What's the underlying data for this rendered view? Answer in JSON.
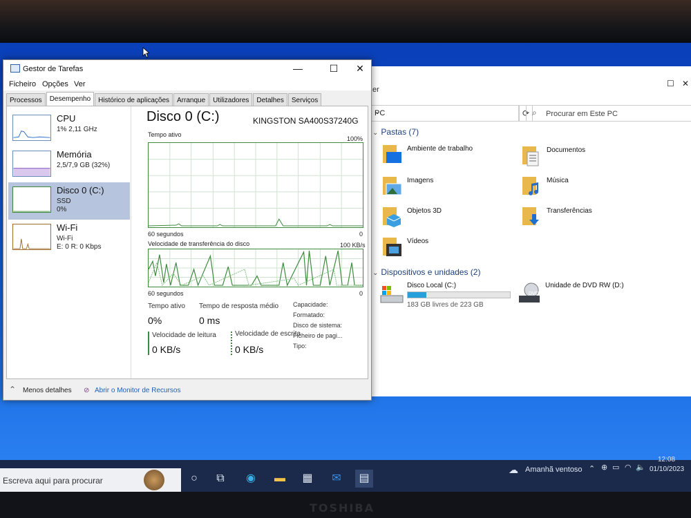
{
  "task_manager": {
    "title": "Gestor de Tarefas",
    "menu": [
      "Ficheiro",
      "Opções",
      "Ver"
    ],
    "tabs": [
      "Processos",
      "Desempenho",
      "Histórico de aplicações",
      "Arranque",
      "Utilizadores",
      "Detalhes",
      "Serviços"
    ],
    "active_tab": "Desempenho",
    "perf_items": [
      {
        "name": "CPU",
        "line1": "1% 2,11 GHz",
        "line2": ""
      },
      {
        "name": "Memória",
        "line1": "2,5/7,9 GB (32%)",
        "line2": ""
      },
      {
        "name": "Disco 0 (C:)",
        "line1": "SSD",
        "line2": "0%"
      },
      {
        "name": "Wi-Fi",
        "line1": "Wi-Fi",
        "line2": "E: 0 R: 0 Kbps"
      }
    ],
    "disk": {
      "title": "Disco 0 (C:)",
      "model": "KINGSTON SA400S37240G",
      "graph1_label": "Tempo ativo",
      "graph1_max": "100%",
      "graph1_time": "60 segundos",
      "graph1_min": "0",
      "graph2_label": "Velocidade de transferência do disco",
      "graph2_max": "100 KB/s",
      "graph2_time": "60 segundos",
      "graph2_min": "0",
      "active_time_label": "Tempo ativo",
      "active_time_value": "0%",
      "response_label": "Tempo de resposta médio",
      "response_value": "0 ms",
      "read_label": "Velocidade de leitura",
      "read_value": "0 KB/s",
      "write_label": "Velocidade de escrita",
      "write_value": "0 KB/s",
      "props": [
        "Capacidade:",
        "Formatado:",
        "Disco de sistema:",
        "Ficheiro de pagi...",
        "Tipo:"
      ]
    },
    "footer": {
      "less_details": "Menos detalhes",
      "resource_monitor": "Abrir o Monitor de Recursos"
    }
  },
  "explorer": {
    "title_partial": "er",
    "address": "PC",
    "search_placeholder": "Procurar em Este PC",
    "folders_header": "Pastas (7)",
    "folders": [
      "Ambiente de trabalho",
      "Documentos",
      "Imagens",
      "Música",
      "Objetos 3D",
      "Transferências",
      "Vídeos"
    ],
    "devices_header": "Dispositivos e unidades (2)",
    "drive_c": {
      "label": "Disco Local (C:)",
      "free": "183 GB livres de 223 GB",
      "used_fraction": 0.18
    },
    "drive_dvd": {
      "label": "Unidade de DVD RW (D:)",
      "badge": "DVD"
    }
  },
  "taskbar": {
    "search_placeholder": "Escreva aqui para procurar",
    "weather": "Amanhã ventoso",
    "time": "12:08",
    "date": "01/10/2023"
  },
  "bezel_brand": "TOSHIBA",
  "colors": {
    "graph_green": "#3d8a3d",
    "selected_item": "#b6c5dd",
    "drive_bar": "#26a0da",
    "taskbar": "#1b2a4a"
  }
}
